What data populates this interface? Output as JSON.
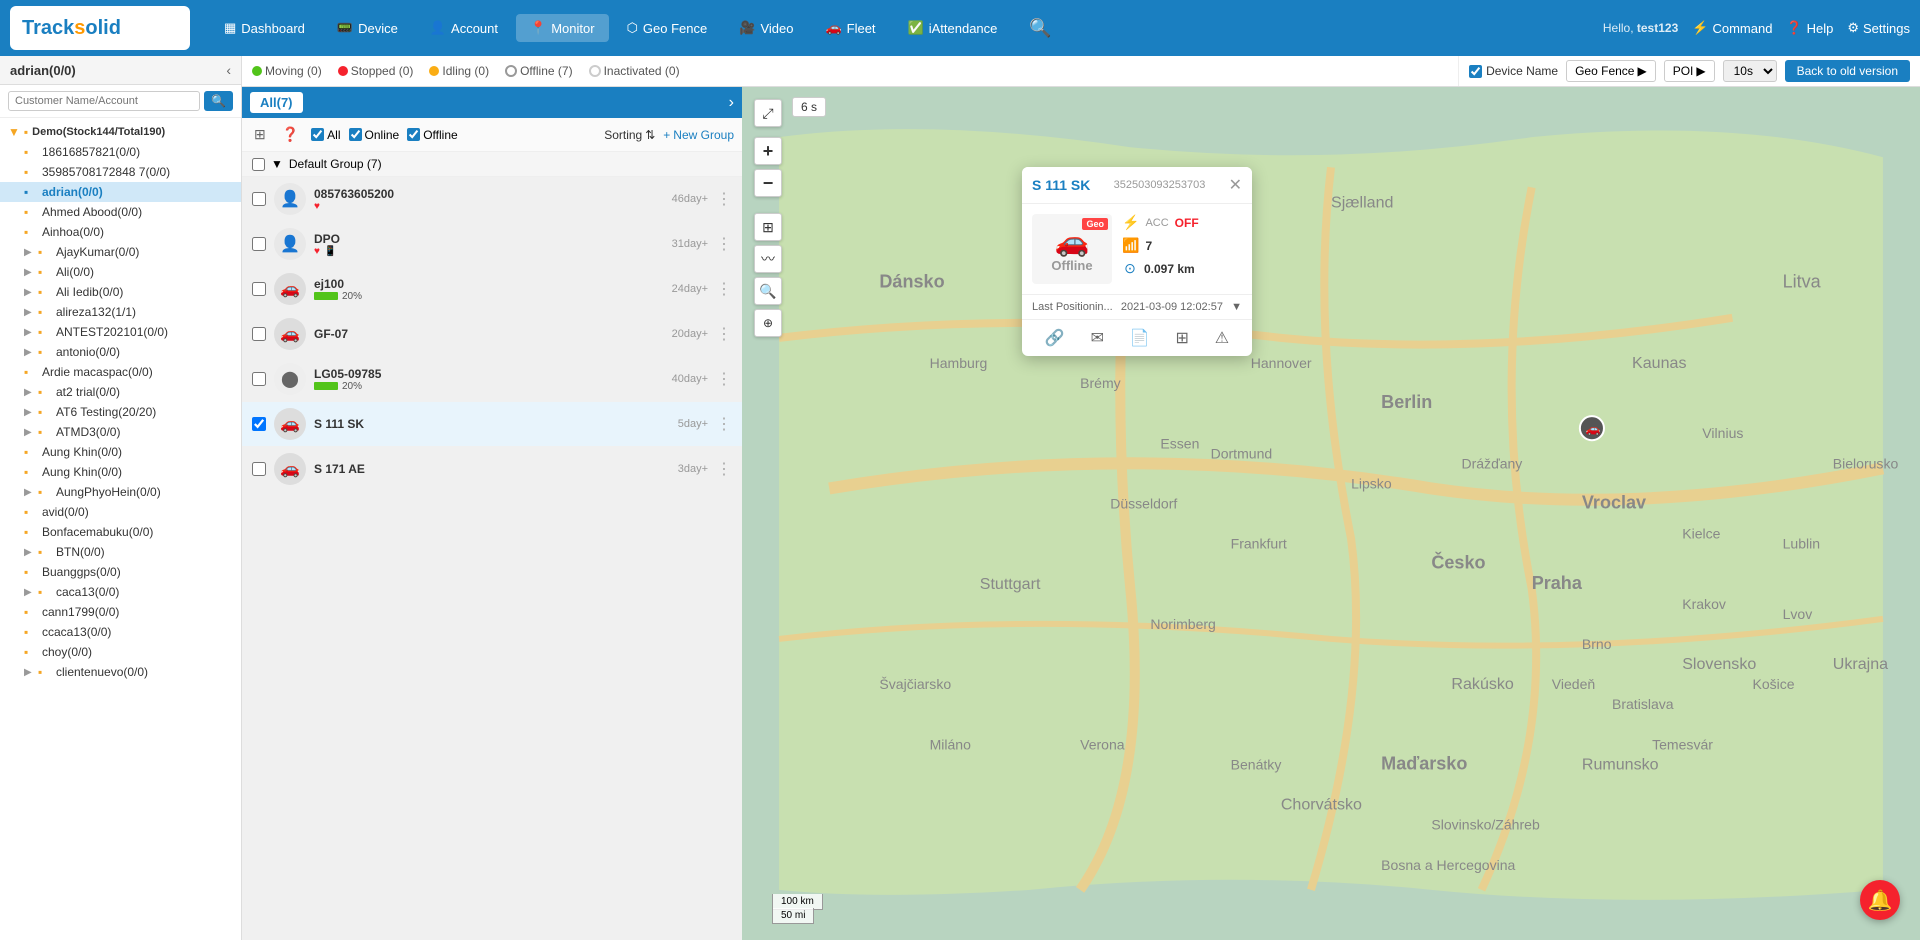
{
  "app": {
    "logo": "Track solid",
    "logo_dot": "·"
  },
  "header": {
    "user_greeting": "Hello,",
    "username": "test123",
    "nav_items": [
      {
        "id": "dashboard",
        "icon": "▦",
        "label": "Dashboard"
      },
      {
        "id": "device",
        "icon": "📱",
        "label": "Device"
      },
      {
        "id": "account",
        "icon": "👤",
        "label": "Account"
      },
      {
        "id": "monitor",
        "icon": "📍",
        "label": "Monitor"
      },
      {
        "id": "geo_fence",
        "icon": "⬡",
        "label": "Geo Fence"
      },
      {
        "id": "video",
        "icon": "🎥",
        "label": "Video"
      },
      {
        "id": "fleet",
        "icon": "🚗",
        "label": "Fleet"
      },
      {
        "id": "iattendance",
        "icon": "✅",
        "label": "iAttendance"
      }
    ],
    "command": "Command",
    "help": "Help",
    "settings": "Settings"
  },
  "left_panel": {
    "title": "adrian(0/0)",
    "search_placeholder": "Customer Name/Account",
    "tree": [
      {
        "id": "demo",
        "label": "Demo(Stock144/Total190)",
        "type": "group",
        "expanded": true,
        "icon": "▼"
      },
      {
        "id": "18616857821",
        "label": "18616857821(0/0)",
        "type": "user",
        "indent": 1
      },
      {
        "id": "35985708172",
        "label": "35985708172848 7(0/0)",
        "type": "user",
        "indent": 1
      },
      {
        "id": "adrian",
        "label": "adrian(0/0)",
        "type": "user",
        "indent": 1,
        "active": true
      },
      {
        "id": "ahmed",
        "label": "Ahmed Abood(0/0)",
        "type": "user",
        "indent": 1
      },
      {
        "id": "ainhoa",
        "label": "Ainhoa(0/0)",
        "type": "user",
        "indent": 1
      },
      {
        "id": "ajay",
        "label": "AjayKumar(0/0)",
        "type": "user",
        "indent": 1,
        "has_arrow": true
      },
      {
        "id": "ali",
        "label": "Ali(0/0)",
        "type": "user",
        "indent": 1,
        "has_arrow": true
      },
      {
        "id": "ali_iedib",
        "label": "Ali Iedib(0/0)",
        "type": "user",
        "indent": 1,
        "has_arrow": true
      },
      {
        "id": "alireza",
        "label": "alireza132(1/1)",
        "type": "user",
        "indent": 1,
        "has_arrow": true
      },
      {
        "id": "antest",
        "label": "ANTEST202101(0/0)",
        "type": "user",
        "indent": 1,
        "has_arrow": true
      },
      {
        "id": "antonio",
        "label": "antonio(0/0)",
        "type": "user",
        "indent": 1,
        "has_arrow": true
      },
      {
        "id": "ardie",
        "label": "Ardie macaspac(0/0)",
        "type": "user",
        "indent": 1
      },
      {
        "id": "at2trial",
        "label": "at2 trial(0/0)",
        "type": "user",
        "indent": 1,
        "has_arrow": true
      },
      {
        "id": "at6testing",
        "label": "AT6 Testing(20/20)",
        "type": "user",
        "indent": 1,
        "has_arrow": true
      },
      {
        "id": "atmd3",
        "label": "ATMD3(0/0)",
        "type": "user",
        "indent": 1,
        "has_arrow": true
      },
      {
        "id": "aung_khin",
        "label": "Aung Khin(0/0)",
        "type": "user",
        "indent": 1
      },
      {
        "id": "aung_khin2",
        "label": "Aung Khin(0/0)",
        "type": "user",
        "indent": 1
      },
      {
        "id": "aung_phyo",
        "label": "AungPhyoHein(0/0)",
        "type": "user",
        "indent": 1,
        "has_arrow": true
      },
      {
        "id": "avid",
        "label": "avid(0/0)",
        "type": "user",
        "indent": 1
      },
      {
        "id": "bonfacemabuku",
        "label": "Bonfacemabuku(0/0)",
        "type": "user",
        "indent": 1
      },
      {
        "id": "btn",
        "label": "BTN(0/0)",
        "type": "user",
        "indent": 1,
        "has_arrow": true
      },
      {
        "id": "buanggps",
        "label": "Buanggps(0/0)",
        "type": "user",
        "indent": 1
      },
      {
        "id": "caca13",
        "label": "caca13(0/0)",
        "type": "user",
        "indent": 1,
        "has_arrow": true
      },
      {
        "id": "cann1799",
        "label": "cann1799(0/0)",
        "type": "user",
        "indent": 1
      },
      {
        "id": "ccaca13",
        "label": "ccaca13(0/0)",
        "type": "user",
        "indent": 1
      },
      {
        "id": "choy",
        "label": "choy(0/0)",
        "type": "user",
        "indent": 1
      },
      {
        "id": "clientenuevo",
        "label": "clientenuevo(0/0)",
        "type": "user",
        "indent": 1,
        "has_arrow": true
      }
    ]
  },
  "middle_panel": {
    "all_count": "All(7)",
    "toolbar": {
      "filter_all": "All",
      "filter_online": "Online",
      "filter_offline": "Offline",
      "sorting": "Sorting",
      "new_group": "New Group"
    },
    "group_header": "Default Group (7)",
    "devices": [
      {
        "id": "dev1",
        "name": "085763605200",
        "age": "46day+",
        "type": "person",
        "checked": false,
        "heart": true,
        "mobile": false
      },
      {
        "id": "dev2",
        "name": "DPO",
        "age": "31day+",
        "type": "person",
        "checked": false,
        "heart": true,
        "mobile": true
      },
      {
        "id": "dev3",
        "name": "ej100",
        "age": "24day+",
        "type": "car",
        "checked": false,
        "battery": "20%"
      },
      {
        "id": "dev4",
        "name": "GF-07",
        "age": "20day+",
        "type": "car",
        "checked": false
      },
      {
        "id": "dev5",
        "name": "LG05-09785",
        "age": "40day+",
        "type": "car",
        "checked": false,
        "battery": "20%"
      },
      {
        "id": "dev6",
        "name": "S 111 SK",
        "age": "5day+",
        "type": "car",
        "checked": true
      },
      {
        "id": "dev7",
        "name": "S 171 AE",
        "age": "3day+",
        "type": "car",
        "checked": false
      }
    ]
  },
  "status_bar": {
    "moving": "Moving (0)",
    "stopped": "Stopped (0)",
    "idling": "Idling (0)",
    "offline": "Offline (7)",
    "inactivated": "Inactivated (0)"
  },
  "map_controls": {
    "timer": "6 s",
    "zoom_in": "+",
    "zoom_out": "−"
  },
  "map_top_bar": {
    "device_name_label": "Device Name",
    "geo_fence": "Geo Fence",
    "poi": "POI",
    "interval": "10s",
    "back_old_version": "Back to old version"
  },
  "device_popup": {
    "title": "S 111 SK",
    "device_id": "352503093253703",
    "status": "Offline",
    "geo_tag": "Geo",
    "acc_label": "OFF",
    "signal_value": "7",
    "distance": "0.097 km",
    "last_position_label": "Last Positionin...",
    "last_position_time": "2021-03-09 12:02:57",
    "actions": [
      "link",
      "mail",
      "doc",
      "grid",
      "warning"
    ]
  },
  "map_scale": {
    "label1": "100 km",
    "label2": "50 mi"
  },
  "colors": {
    "primary": "#1a7fc1",
    "moving": "#52c41a",
    "stopped": "#f5222d",
    "idle": "#faad14",
    "offline": "#999999",
    "inactive": "#d9d9d9"
  }
}
